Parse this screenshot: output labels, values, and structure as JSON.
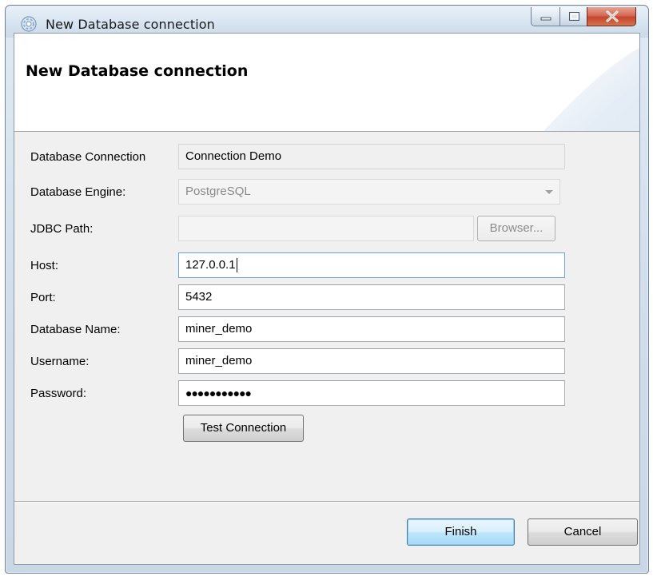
{
  "window": {
    "title": "New Database connection",
    "controls": {
      "minimize": "minimize",
      "maximize": "maximize",
      "close": "close"
    }
  },
  "banner": {
    "title": "New Database connection"
  },
  "form": {
    "connection": {
      "label": "Database Connection",
      "value": "Connection Demo"
    },
    "engine": {
      "label": "Database Engine:",
      "value": "PostgreSQL"
    },
    "jdbc": {
      "label": "JDBC Path:",
      "value": "",
      "browse_label": "Browser..."
    },
    "host": {
      "label": "Host:",
      "value": "127.0.0.1"
    },
    "port": {
      "label": "Port:",
      "value": "5432"
    },
    "dbname": {
      "label": "Database Name:",
      "value": "miner_demo"
    },
    "username": {
      "label": "Username:",
      "value": "miner_demo"
    },
    "password": {
      "label": "Password:",
      "value": "●●●●●●●●●●●"
    },
    "test_label": "Test Connection"
  },
  "footer": {
    "finish_label": "Finish",
    "cancel_label": "Cancel"
  }
}
